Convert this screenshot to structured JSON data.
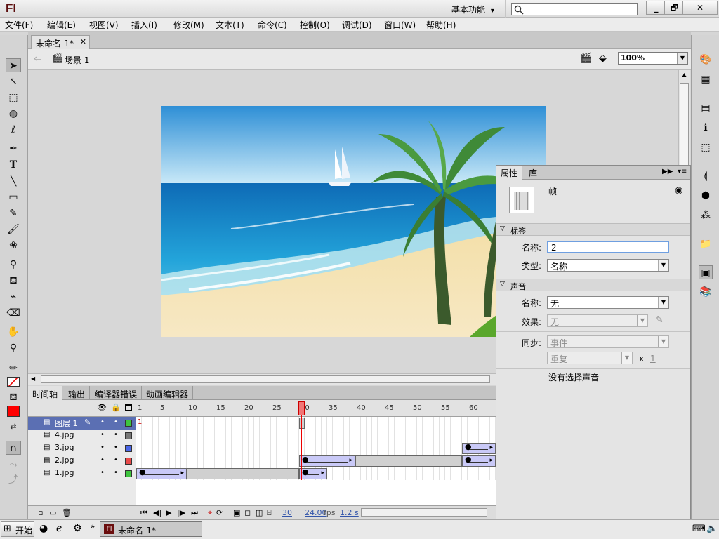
{
  "app": {
    "logo": "Fl",
    "workspace": "基本功能",
    "workspace_arrow": "▾",
    "search_placeholder": ""
  },
  "window_buttons": [
    "_",
    "🗗",
    "✕"
  ],
  "menu": [
    "文件(F)",
    "编辑(E)",
    "视图(V)",
    "插入(I)",
    "修改(M)",
    "文本(T)",
    "命令(C)",
    "控制(O)",
    "调试(D)",
    "窗口(W)",
    "帮助(H)"
  ],
  "document": {
    "tab": "未命名-1*",
    "close": "✕"
  },
  "editbar": {
    "scene": "场景 1",
    "zoom": "100%"
  },
  "properties": {
    "tabs": [
      "属性",
      "库"
    ],
    "header": "帧",
    "sections": {
      "label": "标签",
      "sound": "声音"
    },
    "label_name_lbl": "名称:",
    "label_name_val": "2",
    "label_type_lbl": "类型:",
    "label_type_val": "名称",
    "sound_name_lbl": "名称:",
    "sound_name_val": "无",
    "effect_lbl": "效果:",
    "effect_val": "无",
    "sync_lbl": "同步:",
    "sync_val": "事件",
    "repeat_val": "重复",
    "repeat_x": "x",
    "repeat_count": "1",
    "no_sound": "没有选择声音"
  },
  "timeline": {
    "tabs": [
      "时间轴",
      "输出",
      "编译器错误",
      "动画编辑器"
    ],
    "frame_numbers": [
      "1",
      "5",
      "10",
      "15",
      "20",
      "25",
      "30",
      "35",
      "40",
      "45",
      "50",
      "55",
      "60"
    ],
    "playhead_frame": 30,
    "layers": [
      {
        "name": "图层 1",
        "color": "#3ec43e",
        "selected": true
      },
      {
        "name": "4.jpg",
        "color": "#777777",
        "selected": false
      },
      {
        "name": "3.jpg",
        "color": "#4a66e8",
        "selected": false
      },
      {
        "name": "2.jpg",
        "color": "#e84a4a",
        "selected": false
      },
      {
        "name": "1.jpg",
        "color": "#3ec43e",
        "selected": false
      }
    ],
    "layer1_frame_label": "1",
    "current_frame": "30",
    "fps": "24.00",
    "fps_unit": "fps",
    "elapsed": "1.2 s"
  },
  "taskbar": {
    "start": "开始",
    "task": "未命名-1*",
    "chevron": "»"
  },
  "colors": {
    "stroke": "#000000",
    "fill": "#ff0000",
    "accent": "#5b6fb3"
  }
}
